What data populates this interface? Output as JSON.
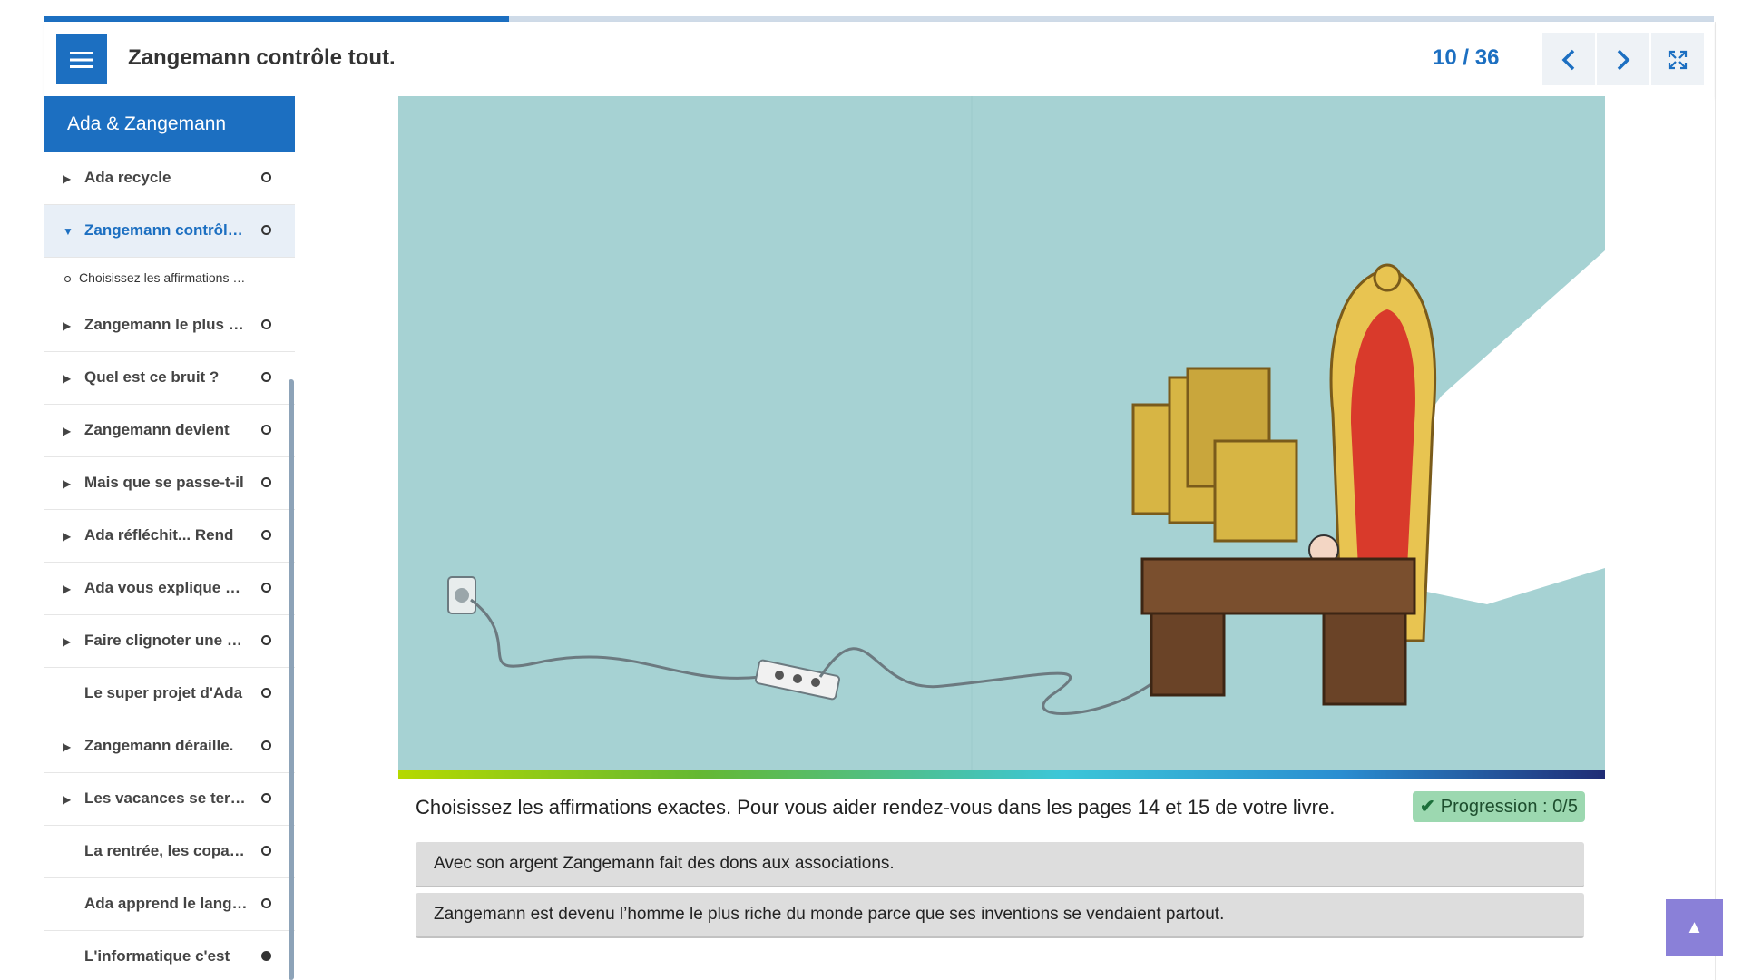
{
  "header": {
    "title": "Zangemann contrôle tout.",
    "current_page": "10",
    "separator": "/",
    "total_pages": "36",
    "reading_progress_fraction": 0.278
  },
  "icons": {
    "menu": "menu-icon",
    "prev": "chevron-left-icon",
    "next": "chevron-right-icon",
    "fullscreen": "fullscreen-icon",
    "scroll_top": "arrow-up-icon"
  },
  "colors": {
    "accent": "#1c6fc1",
    "badge_bg": "#9cd8b0",
    "option_bg": "#dddddd",
    "scroll_top_bg": "#8a80d8"
  },
  "sidebar": {
    "title": "Ada & Zangemann",
    "items": [
      {
        "label": "Ada recycle",
        "expandable": true,
        "state": "open-circle"
      },
      {
        "label": "Zangemann contrôle tout.",
        "expandable": true,
        "expanded": true,
        "active": true,
        "state": "open-circle"
      },
      {
        "label": "Choisissez les affirmations exactes",
        "sub": true
      },
      {
        "label": "Zangemann le plus riche",
        "expandable": true,
        "state": "open-circle"
      },
      {
        "label": "Quel est ce bruit ?",
        "expandable": true,
        "state": "open-circle"
      },
      {
        "label": "Zangemann devient",
        "expandable": true,
        "state": "open-circle"
      },
      {
        "label": "Mais que se passe-t-il",
        "expandable": true,
        "state": "open-circle"
      },
      {
        "label": "Ada réfléchit... Rend",
        "expandable": true,
        "state": "open-circle"
      },
      {
        "label": "Ada vous explique comment",
        "expandable": true,
        "state": "open-circle"
      },
      {
        "label": "Faire clignoter une LED",
        "expandable": true,
        "state": "open-circle"
      },
      {
        "label": "Le super projet d'Ada",
        "expandable": false,
        "state": "open-circle"
      },
      {
        "label": "Zangemann déraille.",
        "expandable": true,
        "state": "open-circle"
      },
      {
        "label": "Les vacances se terminent",
        "expandable": true,
        "state": "open-circle"
      },
      {
        "label": "La rentrée, les copains",
        "expandable": false,
        "state": "open-circle"
      },
      {
        "label": "Ada apprend le langage",
        "expandable": false,
        "state": "open-circle"
      },
      {
        "label": "L'informatique c'est",
        "expandable": false,
        "state": "filled-circle"
      }
    ]
  },
  "main": {
    "illustration": "Zangemann at his golden desk with screens, cable plugged into a power strip",
    "question": "Choisissez les affirmations exactes. Pour vous aider rendez-vous dans les pages 14 et 15 de votre livre.",
    "progress_label": "Progression : 0/5",
    "options": [
      "Avec son argent Zangemann fait des dons aux associations.",
      "Zangemann est devenu l’homme le plus riche du monde parce que ses inventions se vendaient partout."
    ]
  }
}
